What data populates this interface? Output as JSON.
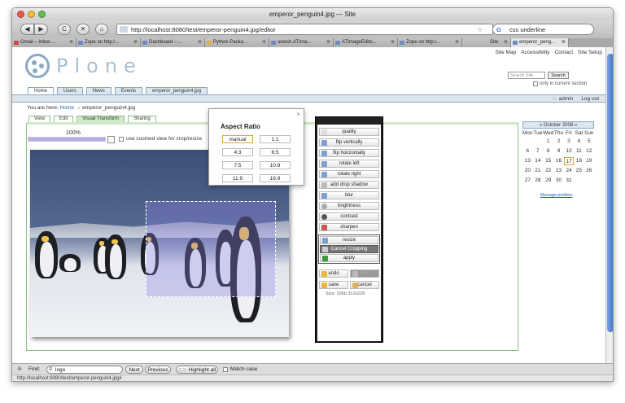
{
  "window": {
    "title": "emperor_penguin4.jpg — Site"
  },
  "nav": {
    "back": "◀",
    "forward": "▶",
    "reload": "C",
    "home": "⌂",
    "url": "http://localhost:8080/test/emperor-penguin4.jpg/editor",
    "search_value": "css underline"
  },
  "tabs": [
    {
      "label": "Gmail – Inbox ..."
    },
    {
      "label": "Zope on http:/..."
    },
    {
      "label": "Dashboard – ..."
    },
    {
      "label": "Python Packa..."
    },
    {
      "label": "uwosh.ATIma..."
    },
    {
      "label": "ATImageEdito..."
    },
    {
      "label": "Zope on http:/..."
    },
    {
      "label": "Site"
    },
    {
      "label": "emperor_peng..."
    }
  ],
  "plone": {
    "logo_text": "Plone",
    "site_links": [
      "Site Map",
      "Accessibility",
      "Contact",
      "Site Setup"
    ],
    "search_placeholder": "Search Site",
    "search_button": "Search",
    "only_current": "only in current section",
    "portal_tabs": [
      "Home",
      "Users",
      "News",
      "Events",
      "emperor_penguin4.jpg"
    ],
    "user": {
      "name": "admin",
      "logout": "Log out"
    },
    "breadcrumb": {
      "prefix": "You are here:",
      "home": "Home",
      "arrow": "→",
      "current": "emperor_penguin4.jpg"
    },
    "content_tabs": [
      "View",
      "Edit",
      "Visual Transform",
      "Sharing"
    ]
  },
  "editor": {
    "zoom_percent": "100%",
    "zoom_label": "use zoomed view for crop/resize",
    "aspect_dialog": {
      "title": "Aspect Ratio",
      "close": "×",
      "options": [
        "manual",
        "1:1",
        "4:3",
        "6:5",
        "7:5",
        "10:8",
        "11:9",
        "16:9"
      ],
      "selected": "manual"
    },
    "tools": {
      "buttons": [
        "quality",
        "flip vertically",
        "flip horizontally",
        "rotate left",
        "rotate right",
        "add drop shadow",
        "blur",
        "brightness",
        "contrast",
        "sharpen"
      ],
      "crop_group": [
        "resize",
        "Cancel Cropping",
        "apply"
      ],
      "undo": "undo",
      "redo": "redo",
      "save": "save",
      "cancel": "cancel",
      "size_info": "Size: 32kb 312x228"
    }
  },
  "calendar": {
    "header": "« October 2008 »",
    "days": [
      "Mon",
      "Tue",
      "Wed",
      "Thu",
      "Fri",
      "Sat",
      "Sun"
    ],
    "dates": [
      "",
      "",
      "1",
      "2",
      "3",
      "4",
      "5",
      "6",
      "7",
      "8",
      "9",
      "10",
      "11",
      "12",
      "13",
      "14",
      "15",
      "16",
      "17",
      "18",
      "19",
      "20",
      "21",
      "22",
      "23",
      "24",
      "25",
      "26",
      "27",
      "28",
      "29",
      "30",
      "31",
      "",
      ""
    ],
    "today": "17",
    "manage": "Manage portlets"
  },
  "findbar": {
    "label": "Find:",
    "value": "logo",
    "next": "Next",
    "previous": "Previous",
    "highlight": "Highlight all",
    "match_case": "Match case"
  },
  "status": "http://localhost:8080/test/emperor-penguin4.jpg#"
}
